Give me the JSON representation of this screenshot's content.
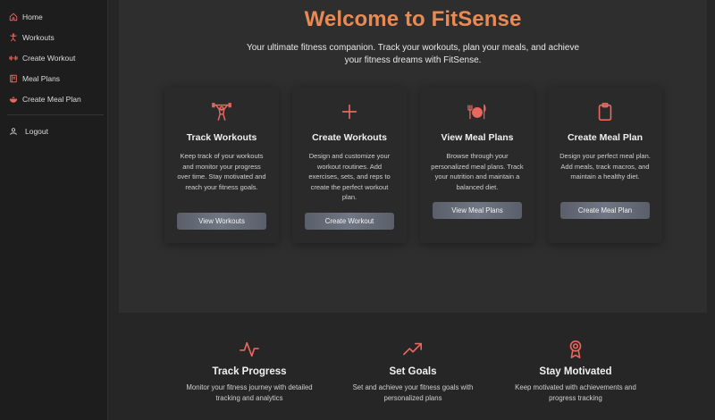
{
  "colors": {
    "accent": "#e88a54",
    "icon_red": "#e8675e",
    "sidebar_bg": "#1d1d1d",
    "panel_bg": "#2e2e2e",
    "page_bg": "#262626",
    "button_bg": "#6a707c"
  },
  "sidebar": {
    "items": [
      {
        "label": "Home",
        "icon": "home-icon"
      },
      {
        "label": "Workouts",
        "icon": "running-figure-icon"
      },
      {
        "label": "Create Workout",
        "icon": "dumbbell-icon"
      },
      {
        "label": "Meal Plans",
        "icon": "book-icon"
      },
      {
        "label": "Create Meal Plan",
        "icon": "bowl-icon"
      }
    ],
    "logout": {
      "label": "Logout",
      "icon": "user-icon"
    }
  },
  "hero": {
    "title": "Welcome to FitSense",
    "subtitle": "Your ultimate fitness companion. Track your workouts, plan your meals, and achieve your fitness dreams with FitSense."
  },
  "cards": [
    {
      "icon": "weightlifter-icon",
      "title": "Track Workouts",
      "description": "Keep track of your workouts and monitor your progress over time. Stay motivated and reach your fitness goals.",
      "button": "View Workouts"
    },
    {
      "icon": "plus-icon",
      "title": "Create Workouts",
      "description": "Design and customize your workout routines. Add exercises, sets, and reps to create the perfect workout plan.",
      "button": "Create Workout"
    },
    {
      "icon": "plate-cutlery-icon",
      "title": "View Meal Plans",
      "description": "Browse through your personalized meal plans. Track your nutrition and maintain a balanced diet.",
      "button": "View Meal Plans"
    },
    {
      "icon": "clipboard-icon",
      "title": "Create Meal Plan",
      "description": "Design your perfect meal plan. Add meals, track macros, and maintain a healthy diet.",
      "button": "Create Meal Plan"
    }
  ],
  "features": [
    {
      "icon": "activity-pulse-icon",
      "title": "Track Progress",
      "description": "Monitor your fitness journey with detailed tracking and analytics"
    },
    {
      "icon": "trending-up-icon",
      "title": "Set Goals",
      "description": "Set and achieve your fitness goals with personalized plans"
    },
    {
      "icon": "award-medal-icon",
      "title": "Stay Motivated",
      "description": "Keep motivated with achievements and progress tracking"
    }
  ]
}
